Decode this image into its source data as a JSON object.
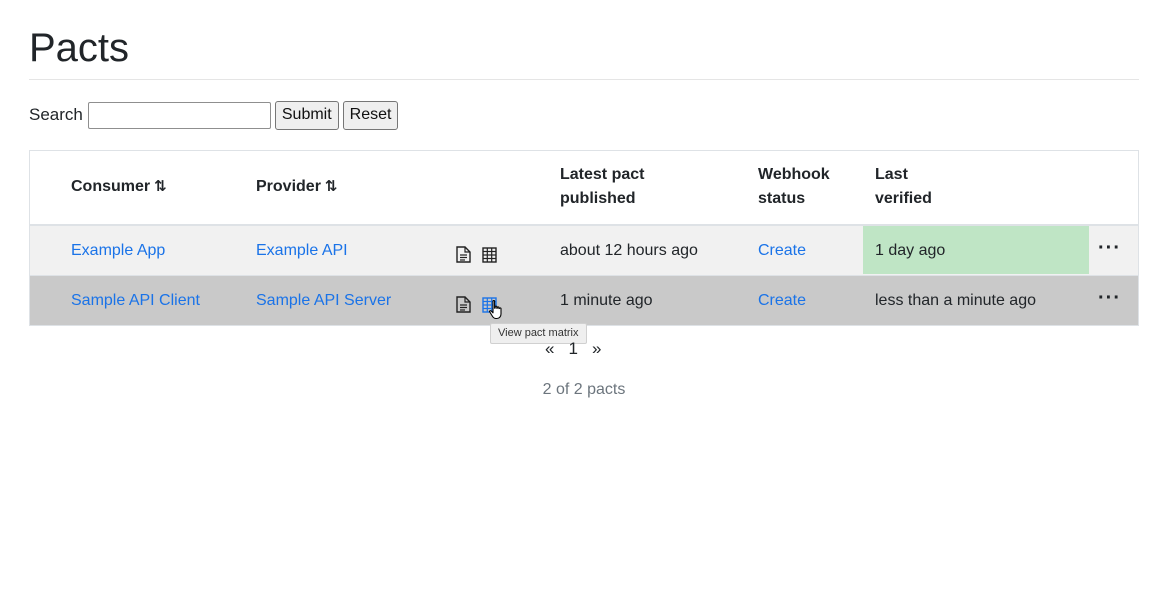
{
  "page": {
    "title": "Pacts"
  },
  "search": {
    "label": "Search",
    "value": "",
    "submit_label": "Submit",
    "reset_label": "Reset"
  },
  "table": {
    "headers": {
      "consumer": "Consumer",
      "provider": "Provider",
      "latest_pact_line1": "Latest pact",
      "latest_pact_line2": "published",
      "webhook_line1": "Webhook",
      "webhook_line2": "status",
      "verified_line1": "Last",
      "verified_line2": "verified"
    },
    "sort_glyph": "⇅",
    "rows": [
      {
        "consumer": "Example App",
        "provider": "Example API",
        "latest_pact": "about 12 hours ago",
        "webhook": "Create",
        "last_verified": "1 day ago",
        "verified_status": "success",
        "menu": "···"
      },
      {
        "consumer": "Sample API Client",
        "provider": "Sample API Server",
        "latest_pact": "1 minute ago",
        "webhook": "Create",
        "last_verified": "less than a minute ago",
        "verified_status": "none",
        "menu": "···"
      }
    ]
  },
  "tooltip": {
    "text": "View pact matrix"
  },
  "pagination": {
    "prev": "«",
    "current": "1",
    "next": "»"
  },
  "summary": {
    "count_text": "2 of 2 pacts"
  },
  "colors": {
    "link": "#1a73e8",
    "verified_success": "#bfe5c5",
    "hover_row": "#c9c9c9"
  }
}
